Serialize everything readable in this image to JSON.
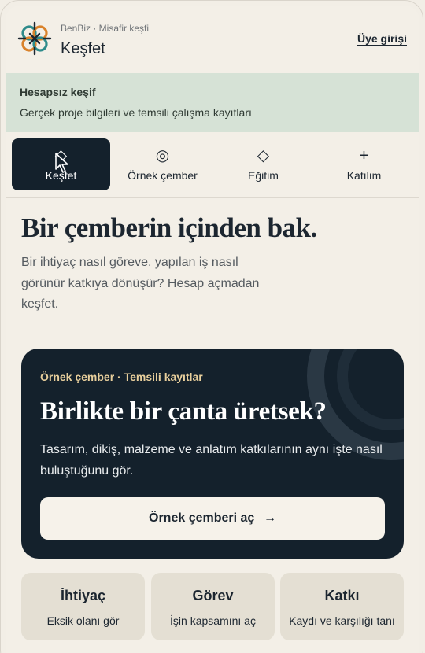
{
  "header": {
    "subtitle": "BenBiz · Misafir keşfi",
    "title": "Keşfet",
    "login_label": "Üye girişi",
    "logo_icon": "knot-logo-icon"
  },
  "banner": {
    "title": "Hesapsız keşif",
    "text": "Gerçek proje bilgileri ve temsili çalışma kayıtları"
  },
  "tabs": [
    {
      "label": "Keşfet",
      "icon": "compass-icon",
      "glyph": "◇",
      "active": true
    },
    {
      "label": "Örnek çember",
      "icon": "target-icon",
      "glyph": "◎",
      "active": false
    },
    {
      "label": "Eğitim",
      "icon": "diamond-icon",
      "glyph": "◇",
      "active": false
    },
    {
      "label": "Katılım",
      "icon": "plus-icon",
      "glyph": "+",
      "active": false
    }
  ],
  "hero": {
    "title": "Bir çemberin içinden bak.",
    "text": "Bir ihtiyaç nasıl göreve, yapılan iş nasıl görünür katkıya dönüşür? Hesap açmadan keşfet."
  },
  "sample": {
    "kicker": "Örnek çember · Temsili kayıtlar",
    "title": "Birlikte bir çanta üretsek?",
    "text": "Tasarım, dikiş, malzeme ve anlatım katkılarının aynı işte nasıl buluştuğunu gör.",
    "button_label": "Örnek çemberi aç",
    "button_arrow": "→"
  },
  "pills": [
    {
      "title": "İhtiyaç",
      "text": "Eksik olanı gör"
    },
    {
      "title": "Görev",
      "text": "İşin kapsamını aç"
    },
    {
      "title": "Katkı",
      "text": "Kaydı ve karşılığı tanı"
    }
  ],
  "colors": {
    "background": "#f3efe7",
    "banner": "#d6e2d6",
    "dark": "#14212c",
    "accent_gold": "#e8cf9c",
    "logo_teal": "#2e8b8b",
    "logo_orange": "#d9822b"
  }
}
